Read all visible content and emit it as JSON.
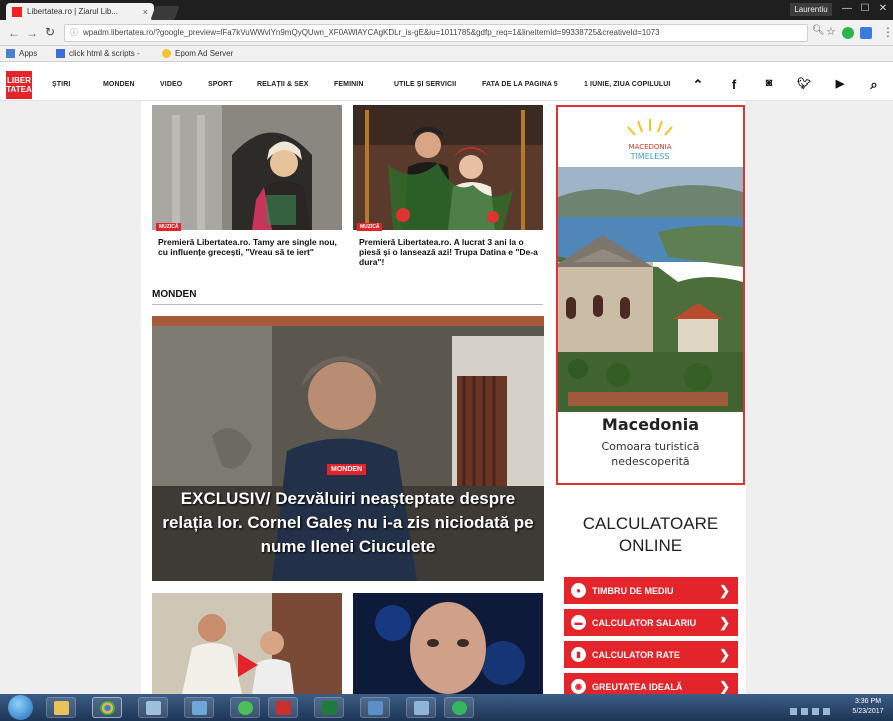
{
  "browser": {
    "tab_title": "Libertatea.ro | Ziarul Lib...",
    "tab_close": "×",
    "user_name": "Laurentiu",
    "window_controls": [
      "—",
      "☐",
      "✕"
    ],
    "url": "wpadm.libertatea.ro/?google_preview=lFa7kVuWWvlYn9mQyQUwn_XF0AWlAYCAgKDLr_is-gE&iu=1011785&gdfp_req=1&lineItemId=99338725&creativeId=1073",
    "bookmarks": [
      "Apps",
      "click html & scripts -",
      "Epom Ad Server"
    ]
  },
  "site": {
    "logo_line1": "LIBER",
    "logo_line2": "TATEA",
    "nav": [
      "ȘTIRI",
      "MONDEN",
      "VIDEO",
      "SPORT",
      "RELAȚII & SEX",
      "FEMININ",
      "UTILE ȘI SERVICII",
      "FATA DE LA PAGINA 5",
      "1 IUNIE, ZIUA COPILULUI"
    ],
    "nav_icons": [
      "chevron-up-icon",
      "facebook-icon",
      "instagram-icon",
      "twitter-icon",
      "youtube-icon",
      "search-icon"
    ]
  },
  "cards": [
    {
      "tag": "MUZICĂ",
      "title": "Premieră Libertatea.ro. Tamy are single nou, cu influențe grecești, \"Vreau să te iert\""
    },
    {
      "tag": "MUZICĂ",
      "title": "Premieră Libertatea.ro. A lucrat 3 ani la o piesă și o lansează azi! Trupa Datina e \"De-a dura\"!"
    }
  ],
  "section_title": "MONDEN",
  "hero": {
    "tag": "MONDEN",
    "title": "EXCLUSIV/ Dezvăluiri neașteptate despre relația lor. Cornel Galeș nu i-a zis niciodată pe nume Ilenei Ciuculete"
  },
  "ad": {
    "brand_line1": "MACEDONIA",
    "brand_line2": "TIMELESS",
    "title": "Macedonia",
    "subtitle_line1": "Comoara turistică",
    "subtitle_line2": "nedescoperită"
  },
  "calculators": {
    "title_line1": "CALCULATOARE",
    "title_line2": "ONLINE",
    "buttons": [
      "TIMBRU DE MEDIU",
      "CALCULATOR SALARIU",
      "CALCULATOR RATE",
      "GREUTATEA IDEALĂ"
    ]
  },
  "taskbar": {
    "time": "3:36 PM",
    "date": "5/23/2017"
  },
  "colors": {
    "brand_red": "#e3242b",
    "chrome_dark": "#1f1f1f",
    "taskbar": "#1d3555"
  }
}
